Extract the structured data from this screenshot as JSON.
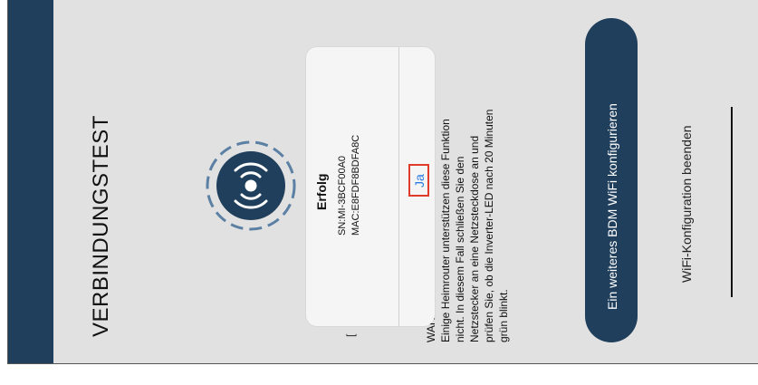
{
  "title": "VERBINDUNGSTEST",
  "status_partial": "[",
  "warning": {
    "lines": [
      "WARI",
      "Einige Heimrouter unterstützen diese Funktion",
      "nicht. In diesem Fall schließen Sie den",
      "Netzstecker an eine Netzsteckdose an und",
      "prüfen Sie, ob die Inverter-LED nach 20 Minuten",
      "grün blinkt."
    ]
  },
  "dialog": {
    "title": "Erfolg",
    "sn": "SN:MI-3BCF00A0",
    "mac": "MAC:E8FDF8BDFA8C",
    "confirm": "Ja"
  },
  "primary_button": "Ein weiteres BDM WiFi konfigurieren",
  "end_link": "WiFi-Konfiguration beenden",
  "colors": {
    "accent": "#1f3f5c",
    "highlight": "#e03a2a",
    "link": "#2a7be0",
    "background": "#e1e1e1"
  },
  "icons": [
    "wifi-signal-icon"
  ]
}
